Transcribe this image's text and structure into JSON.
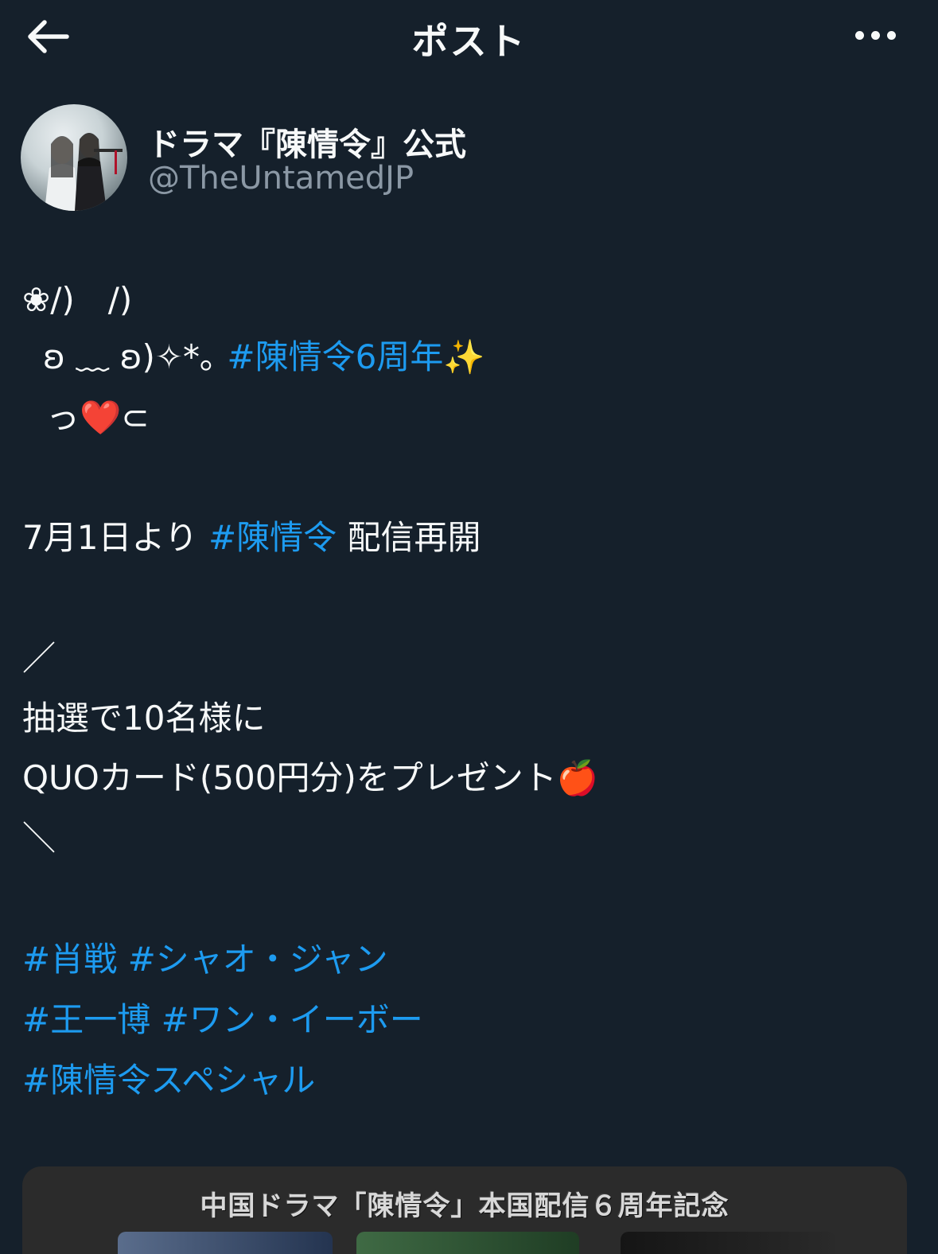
{
  "header": {
    "title": "ポスト",
    "back_icon": "arrow-left-icon",
    "more_icon": "more-horizontal-icon"
  },
  "author": {
    "display_name": "ドラマ『陳情令』公式",
    "handle": "@TheUntamedJP"
  },
  "post": {
    "line1": "❀/)　/)",
    "line2_prefix": "ʚ ﹏ ʚ)✧*｡",
    "line2_tag": "#陳情令6周年",
    "line2_emoji": "✨",
    "line3_prefix": "っ",
    "line3_emoji": "❤️",
    "line3_suffix": "⊂",
    "line4_prefix": "7月1日より",
    "line4_tag": "#陳情令",
    "line4_suffix": "配信再開",
    "line5": "／",
    "line6": "抽選で10名様に",
    "line7": "QUOカード(500円分)をプレゼント",
    "line7_emoji": "🍎",
    "line8": "＼",
    "tags_row1": [
      "#肖戦",
      "#シャオ・ジャン"
    ],
    "tags_row2": [
      "#王一博",
      "#ワン・イーボー"
    ],
    "tags_row3": [
      "#陳情令スペシャル"
    ]
  },
  "media": {
    "caption": "中国ドラマ「陳情令」本国配信６周年記念"
  },
  "colors": {
    "background": "#15202b",
    "link": "#1d9bf0",
    "secondary_text": "#8b98a5"
  }
}
